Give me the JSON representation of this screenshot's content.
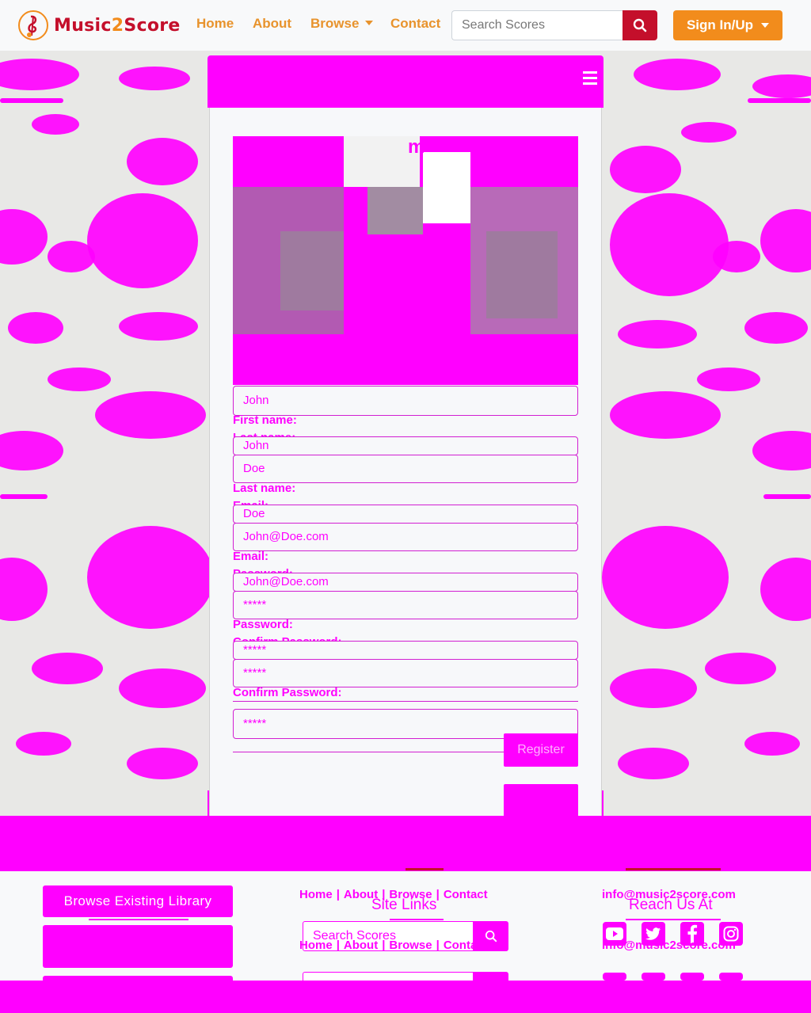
{
  "brand": {
    "name_part1": "Music",
    "name_part2": "2",
    "name_part3": "Score"
  },
  "nav": {
    "home": "Home",
    "about": "About",
    "browse": "Browse",
    "contact": "Contact"
  },
  "search": {
    "placeholder": "Search Scores"
  },
  "account": {
    "label": "Sign In/Up"
  },
  "form": {
    "photo_title": "m",
    "fields": [
      {
        "value": "John"
      },
      {
        "label": "First name:"
      },
      {
        "label": "Last name:"
      },
      {
        "value": "John"
      },
      {
        "value": "Doe"
      },
      {
        "label": "Last name:"
      },
      {
        "label": "Email:"
      },
      {
        "value": "Doe"
      },
      {
        "value": "John@Doe.com"
      },
      {
        "label": "Email:"
      },
      {
        "label": "Password:"
      },
      {
        "value": "John@Doe.com"
      },
      {
        "value": "*****"
      },
      {
        "label": "Password:"
      },
      {
        "label": "Confirm Password:"
      },
      {
        "value": "*****"
      },
      {
        "value": "*****"
      },
      {
        "label": "Confirm Password:"
      },
      {
        "value": "*****"
      }
    ],
    "register_label": "Register"
  },
  "footer": {
    "library_button": "Browse Existing Library",
    "site_links_heading": "Site Links",
    "reach_us_heading": "Reach Us At",
    "links": {
      "home": "Home",
      "about": "About",
      "browse": "Browse",
      "contact": "Contact",
      "separator": "|"
    },
    "email": "info@music2score.com",
    "search_placeholder": "Search Scores"
  },
  "colors": {
    "brand_red": "#c40f2b",
    "brand_orange": "#f28c1c",
    "nav_orange": "#e8932c",
    "magenta": "#ff00ff"
  },
  "icons": [
    "music-note-logo-icon",
    "search-icon",
    "youtube-icon",
    "twitter-icon",
    "facebook-icon",
    "instagram-icon",
    "menu-icon"
  ]
}
